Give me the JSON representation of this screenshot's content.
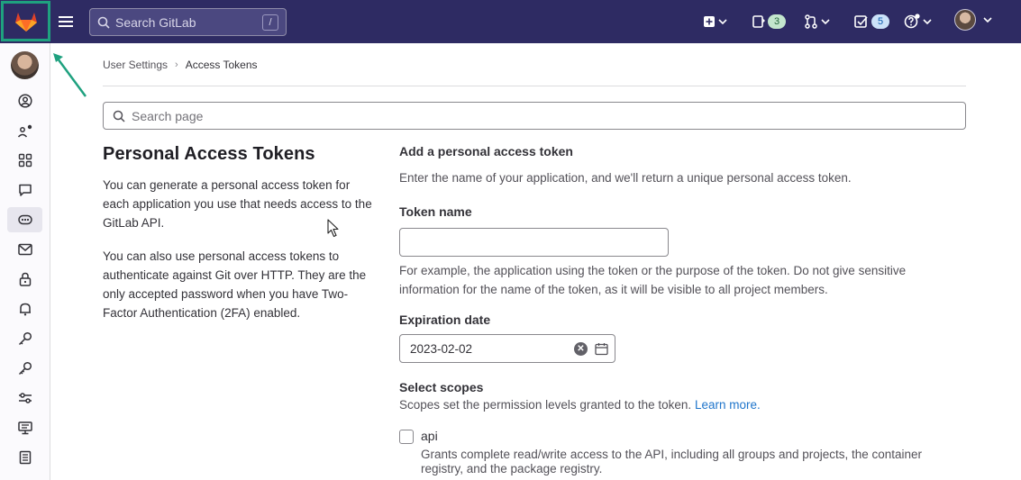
{
  "topbar": {
    "search_placeholder": "Search GitLab",
    "search_shortcut": "/",
    "todo_count": "3",
    "mr_count": "",
    "issues_count": "5",
    "logo_icon": "gitlab-tanuki-icon",
    "colors": {
      "bar": "#2e2b63",
      "logo_highlight": "#1fa17f"
    }
  },
  "sidebar": {
    "items": [
      {
        "icon": "profile-icon"
      },
      {
        "icon": "account-icon"
      },
      {
        "icon": "applications-icon"
      },
      {
        "icon": "chat-icon"
      },
      {
        "icon": "access-tokens-icon",
        "active": true
      },
      {
        "icon": "email-icon"
      },
      {
        "icon": "password-lock-icon"
      },
      {
        "icon": "notifications-bell-icon"
      },
      {
        "icon": "ssh-key-icon"
      },
      {
        "icon": "gpg-key-icon"
      },
      {
        "icon": "preferences-icon"
      },
      {
        "icon": "active-sessions-icon"
      },
      {
        "icon": "auth-log-icon"
      }
    ]
  },
  "breadcrumb": {
    "parent": "User Settings",
    "current": "Access Tokens"
  },
  "page_search": {
    "placeholder": "Search page"
  },
  "left": {
    "title": "Personal Access Tokens",
    "p1": "You can generate a personal access token for each application you use that needs access to the GitLab API.",
    "p2": "You can also use personal access tokens to authenticate against Git over HTTP. They are the only accepted password when you have Two-Factor Authentication (2FA) enabled."
  },
  "form": {
    "heading": "Add a personal access token",
    "intro": "Enter the name of your application, and we'll return a unique personal access token.",
    "token_name_label": "Token name",
    "token_name_value": "",
    "token_help": "For example, the application using the token or the purpose of the token. Do not give sensitive information for the name of the token, as it will be visible to all project members.",
    "expiration_label": "Expiration date",
    "expiration_value": "2023-02-02",
    "scopes_label": "Select scopes",
    "scopes_desc": "Scopes set the permission levels granted to the token.",
    "learn_more": "Learn more.",
    "scopes": [
      {
        "name": "api",
        "checked": false,
        "description": "Grants complete read/write access to the API, including all groups and projects, the container registry, and the package registry."
      }
    ]
  }
}
